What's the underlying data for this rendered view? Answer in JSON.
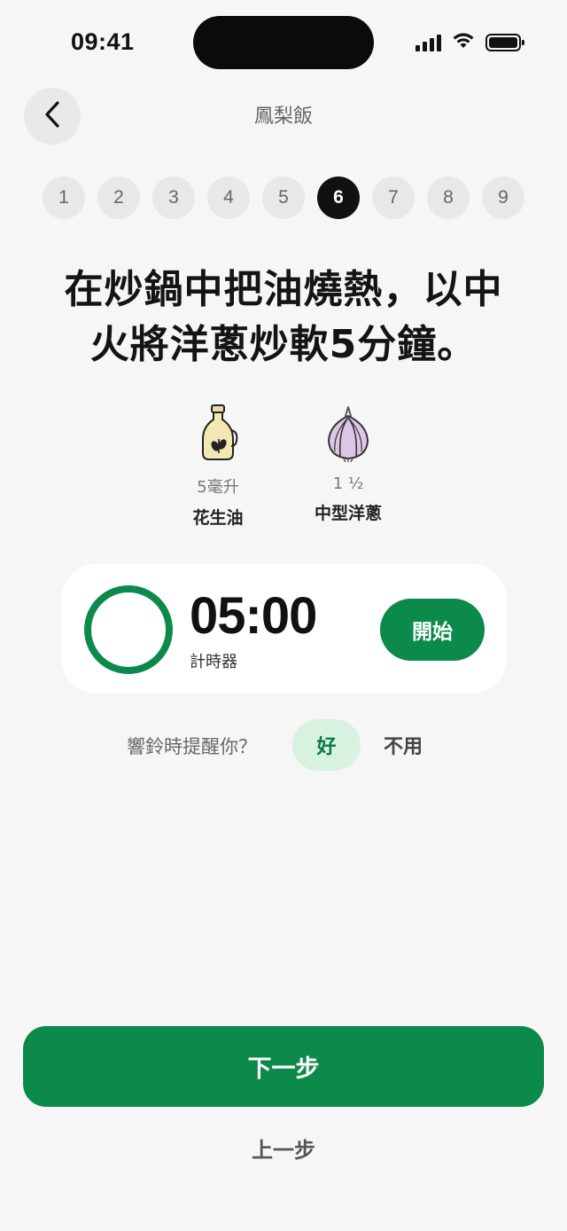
{
  "status_bar": {
    "time": "09:41",
    "icons": [
      "signal-icon",
      "wifi-icon",
      "battery-icon"
    ]
  },
  "header": {
    "back_icon": "chevron-left-icon",
    "title": "鳳梨飯"
  },
  "steps": {
    "items": [
      "1",
      "2",
      "3",
      "4",
      "5",
      "6",
      "7",
      "8",
      "9"
    ],
    "current": "6"
  },
  "instruction": {
    "line1": "在炒鍋中把油燒熱，以中",
    "line2": "火將洋蔥炒軟5分鐘。"
  },
  "ingredients": [
    {
      "icon": "oil-bottle-icon",
      "amount": "5毫升",
      "name": "花生油"
    },
    {
      "icon": "onion-icon",
      "amount": "1 ½",
      "name": "中型洋蔥"
    }
  ],
  "timer": {
    "value": "05:00",
    "label": "計時器",
    "start_label": "開始",
    "progress": 1.0
  },
  "reminder": {
    "question": "響鈴時提醒你？",
    "yes_label": "好",
    "no_label": "不用"
  },
  "footer": {
    "next_label": "下一步",
    "prev_label": "上一步"
  },
  "colors": {
    "accent": "#0c8a4c",
    "accent_light": "#d8f2e2",
    "background": "#f6f6f6",
    "card": "#ffffff",
    "active_step": "#111111"
  }
}
